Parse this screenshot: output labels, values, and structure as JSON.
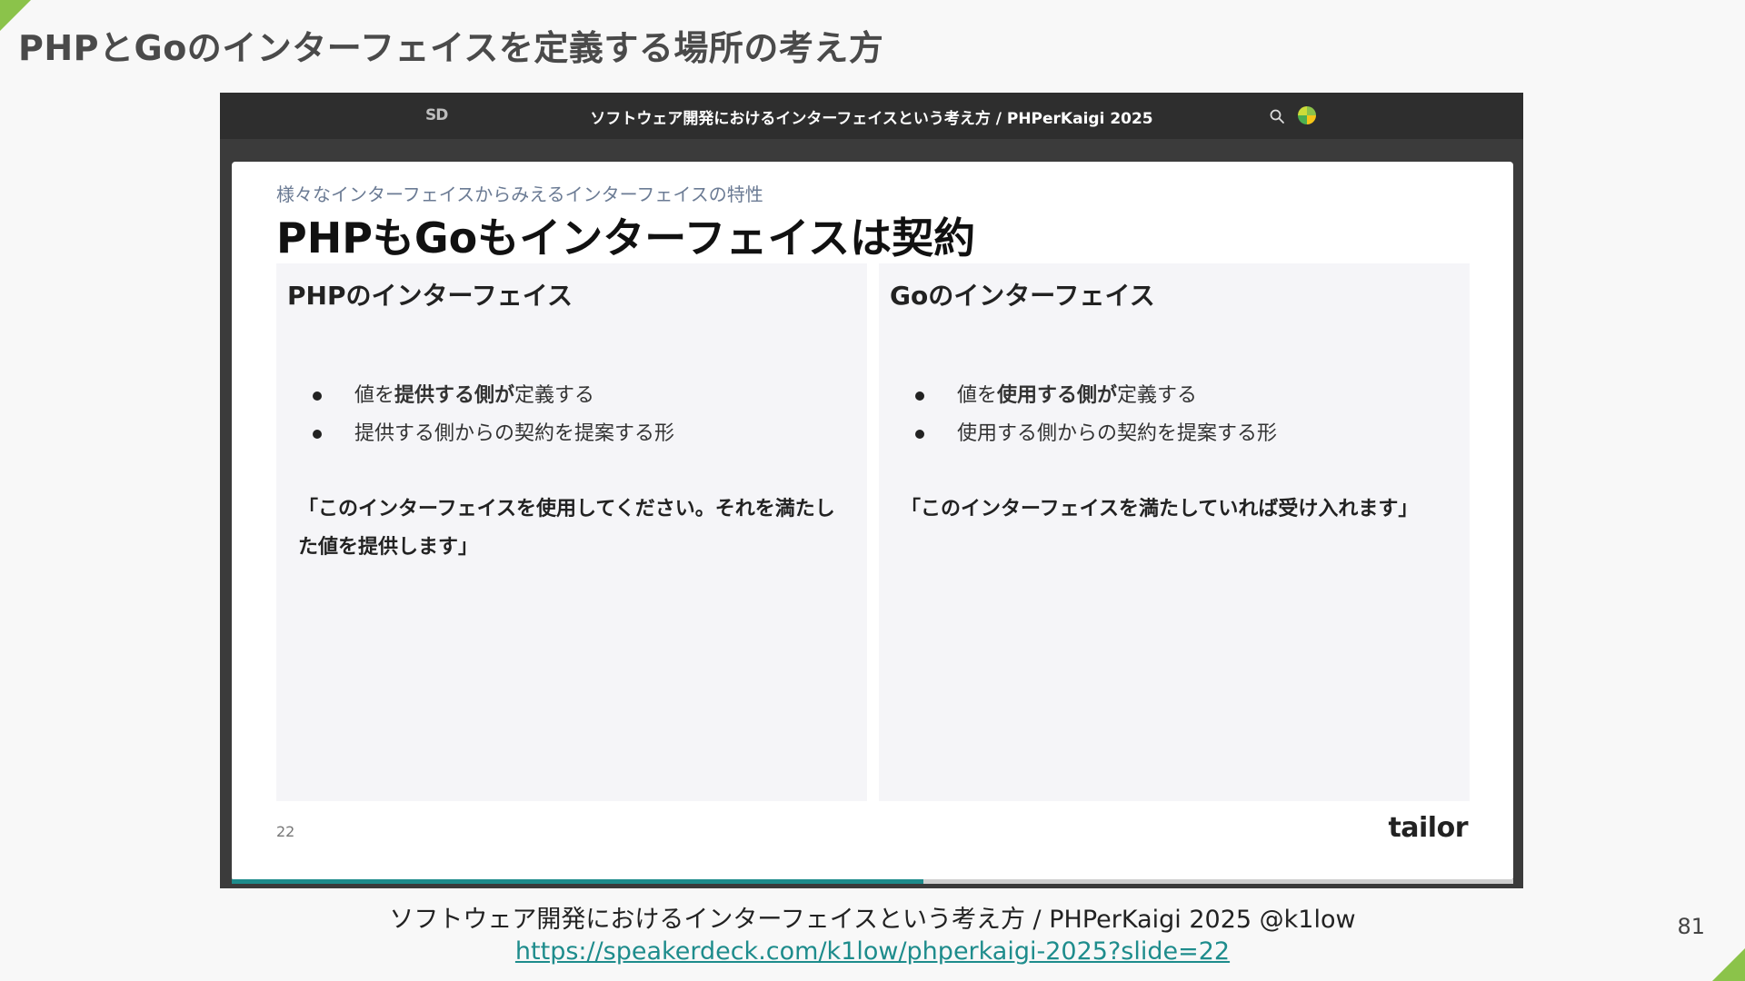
{
  "page": {
    "title": "PHPとGoのインターフェイスを定義する場所の考え方",
    "number": "81",
    "accent_color": "#8bc34a"
  },
  "viewer": {
    "logo": "SD",
    "title": "ソフトウェア開発におけるインターフェイスという考え方 / PHPerKaigi 2025",
    "search_icon": "search-icon",
    "avatar_icon": "avatar-icon",
    "progress": 0.54
  },
  "slide": {
    "kicker": "様々なインターフェイスからみえるインターフェイスの特性",
    "heading": "PHPもGoもインターフェイスは契約",
    "left": {
      "title": "PHPのインターフェイス",
      "bullet1_a": "値を",
      "bullet1_b": "提供する側が",
      "bullet1_c": "定義する",
      "bullet2": "提供する側からの契約を提案する形",
      "quote": "「このインターフェイスを使用してください。それを満たした値を提供します」"
    },
    "right": {
      "title": "Goのインターフェイス",
      "bullet1_a": "値を",
      "bullet1_b": "使用する側が",
      "bullet1_c": "定義する",
      "bullet2": "使用する側からの契約を提案する形",
      "quote": "「このインターフェイスを満たしていれば受け入れます」"
    },
    "number": "22",
    "brand": "tailor"
  },
  "caption": {
    "text": "ソフトウェア開発におけるインターフェイスという考え方 / PHPerKaigi 2025 @k1low",
    "link": "https://speakerdeck.com/k1low/phperkaigi-2025?slide=22"
  }
}
